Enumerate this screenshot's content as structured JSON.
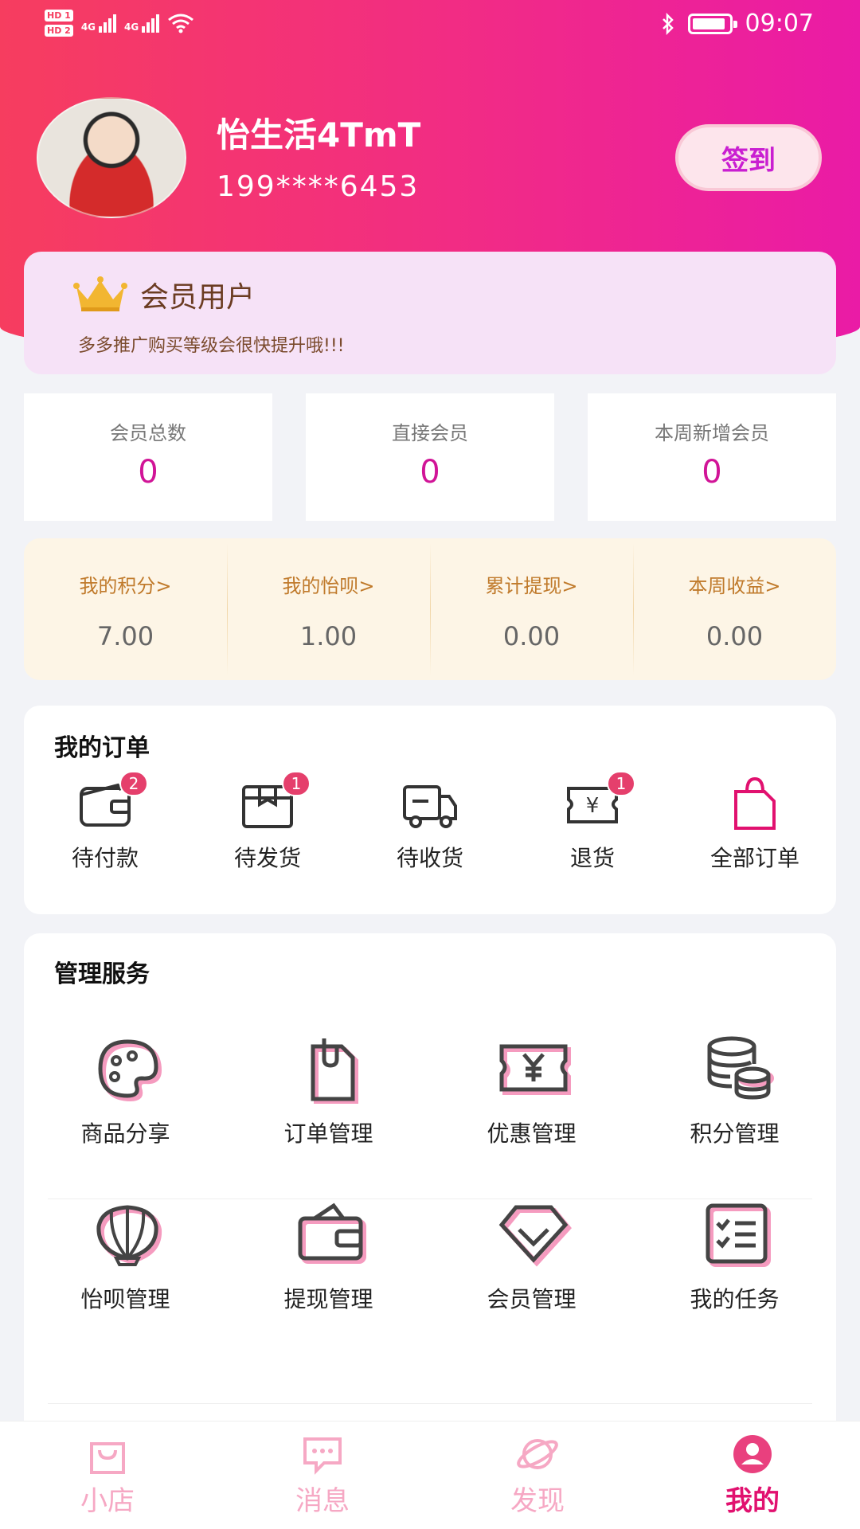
{
  "status_bar": {
    "hd1": "HD 1",
    "hd2": "HD 2",
    "net1": "4G",
    "net2": "4G",
    "time": "09:07"
  },
  "profile": {
    "username": "怡生活4TmT",
    "phone": "199****6453",
    "checkin_label": "签到"
  },
  "member": {
    "title": "会员用户",
    "tip": "多多推广购买等级会很快提升哦!!!"
  },
  "stats": [
    {
      "label": "会员总数",
      "value": "0"
    },
    {
      "label": "直接会员",
      "value": "0"
    },
    {
      "label": "本周新增会员",
      "value": "0"
    }
  ],
  "earnings": [
    {
      "label": "我的积分>",
      "value": "7.00"
    },
    {
      "label": "我的怡呗>",
      "value": "1.00"
    },
    {
      "label": "累计提现>",
      "value": "0.00"
    },
    {
      "label": "本周收益>",
      "value": "0.00"
    }
  ],
  "orders": {
    "title": "我的订单",
    "items": [
      {
        "label": "待付款",
        "badge": "2",
        "icon": "wallet-icon"
      },
      {
        "label": "待发货",
        "badge": "1",
        "icon": "package-icon"
      },
      {
        "label": "待收货",
        "icon": "truck-icon"
      },
      {
        "label": "退货",
        "badge": "1",
        "icon": "refund-ticket-icon"
      },
      {
        "label": "全部订单",
        "icon": "shopping-bag-icon"
      }
    ]
  },
  "services": {
    "title": "管理服务",
    "items": [
      {
        "label": "商品分享",
        "icon": "palette-icon"
      },
      {
        "label": "订单管理",
        "icon": "clipboard-icon"
      },
      {
        "label": "优惠管理",
        "icon": "coupon-icon"
      },
      {
        "label": "积分管理",
        "icon": "coins-icon"
      },
      {
        "label": "怡呗管理",
        "icon": "shell-icon"
      },
      {
        "label": "提现管理",
        "icon": "wallet-cash-icon"
      },
      {
        "label": "会员管理",
        "icon": "diamond-icon"
      },
      {
        "label": "我的任务",
        "icon": "task-list-icon"
      }
    ]
  },
  "tabbar": [
    {
      "label": "小店",
      "icon": "shop-bag-icon"
    },
    {
      "label": "消息",
      "icon": "message-icon"
    },
    {
      "label": "发现",
      "icon": "planet-icon"
    },
    {
      "label": "我的",
      "icon": "user-icon",
      "active": true
    }
  ],
  "colors": {
    "header_gradient_start": "#f63d5f",
    "header_gradient_end": "#ea1ba6",
    "accent_magenta": "#d11497",
    "earn_gold": "#c07a2b",
    "badge_red": "#e53f6c",
    "tab_active": "#e1116f"
  }
}
